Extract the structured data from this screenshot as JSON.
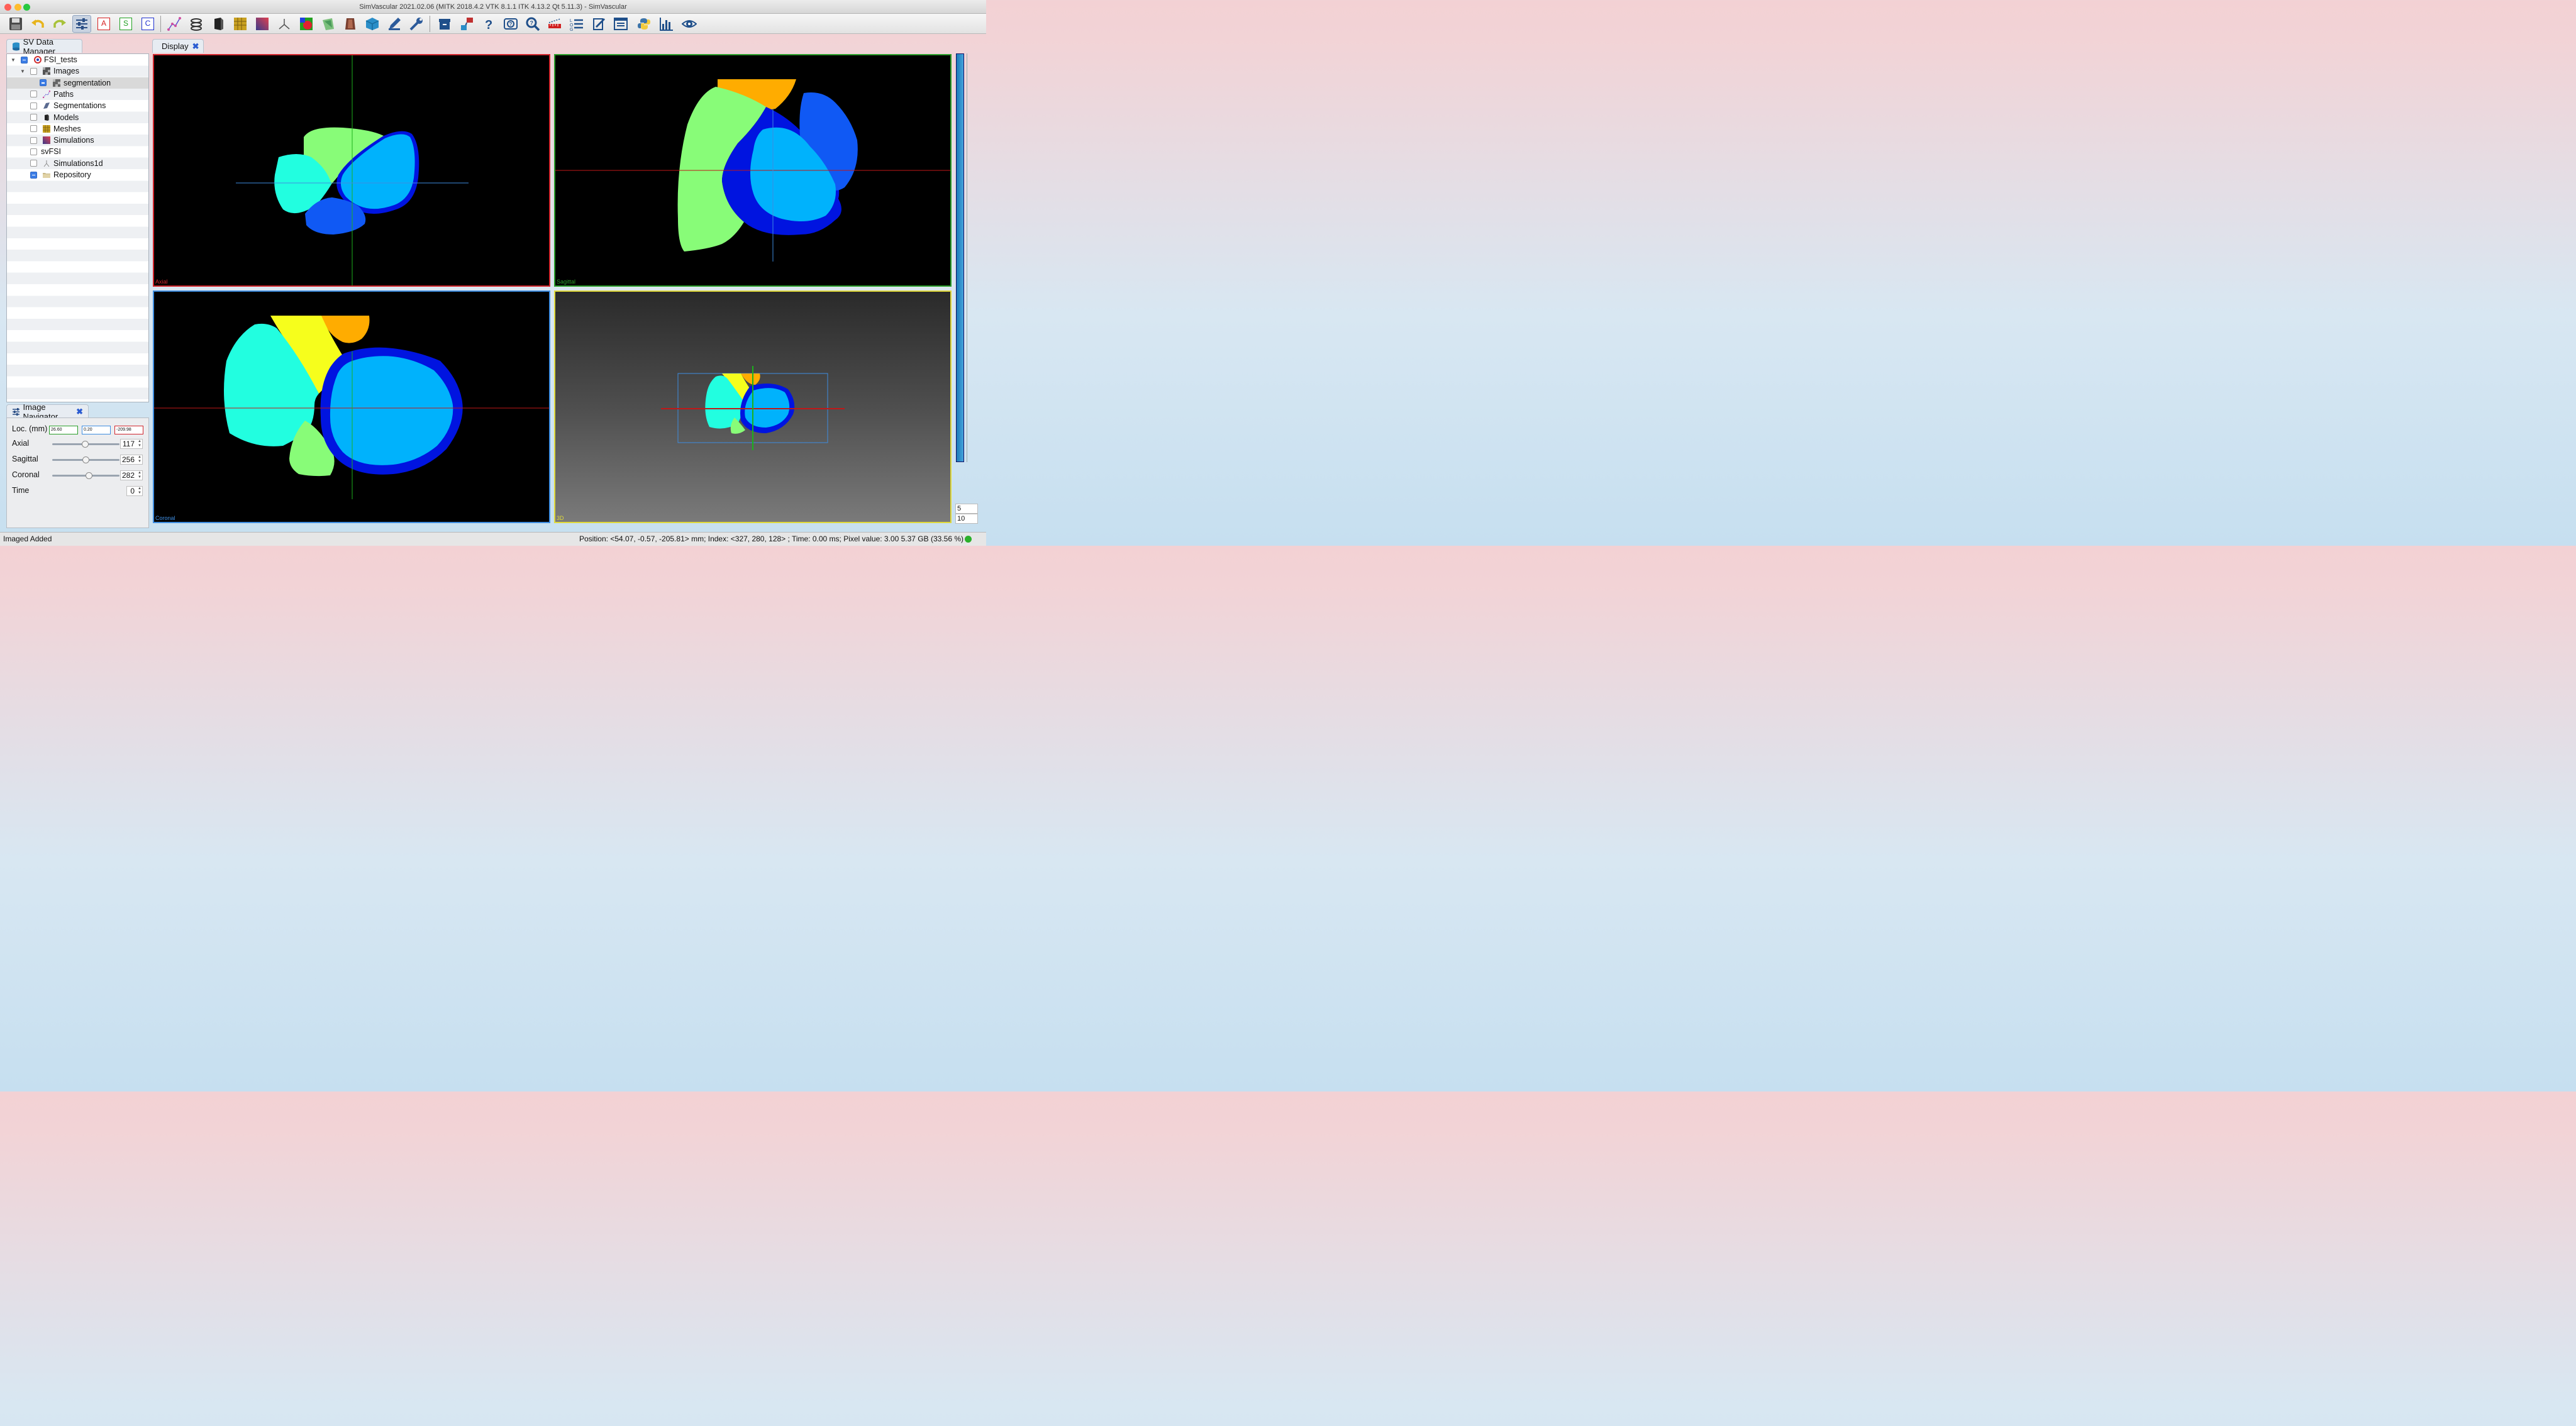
{
  "window": {
    "title": "SimVascular 2021.02.06 (MITK 2018.4.2 VTK 8.1.1 ITK 4.13.2 Qt 5.11.3) - SimVascular"
  },
  "toolbar": {
    "letter_a": "A",
    "letter_s": "S",
    "letter_c": "C",
    "icons": [
      "save-icon",
      "undo-icon",
      "redo-icon",
      "image-navigator-icon",
      "letter-a-icon",
      "letter-s-icon",
      "letter-c-icon",
      "path-planning-icon",
      "segmentation-2d-icon",
      "segmentation-3d-icon",
      "model-icon",
      "mesh-icon",
      "simulation-icon",
      "sim1d-icon",
      "svfsi-icon",
      "rom-icon",
      "warehouse-icon",
      "cube-icon",
      "pen-icon",
      "wrench-icon",
      "archive-icon",
      "transfer-icon",
      "help-icon",
      "about-icon",
      "search-icon",
      "ruler-icon",
      "log-icon",
      "properties-icon",
      "list-icon",
      "python-icon",
      "chart-icon",
      "view-icon"
    ]
  },
  "data_manager": {
    "tab_label": "SV Data Manager",
    "items": [
      {
        "label": "FSI_tests",
        "level": 0,
        "checked": true,
        "expanded": true
      },
      {
        "label": "Images",
        "level": 1,
        "checked": false,
        "expanded": true
      },
      {
        "label": "segmentation",
        "level": 2,
        "checked": true,
        "selected": true
      },
      {
        "label": "Paths",
        "level": 1,
        "checked": false
      },
      {
        "label": "Segmentations",
        "level": 1,
        "checked": false
      },
      {
        "label": "Models",
        "level": 1,
        "checked": false
      },
      {
        "label": "Meshes",
        "level": 1,
        "checked": false
      },
      {
        "label": "Simulations",
        "level": 1,
        "checked": false
      },
      {
        "label": "svFSI",
        "level": 1,
        "checked": false
      },
      {
        "label": "Simulations1d",
        "level": 1,
        "checked": false
      },
      {
        "label": "Repository",
        "level": 1,
        "checked": true
      }
    ]
  },
  "navigator": {
    "tab_label": "Image Navigator",
    "loc_label": "Loc. (mm)",
    "loc_x": "26.60",
    "loc_y": "0.20",
    "loc_z": "-209.98",
    "axial_label": "Axial",
    "axial_value": "117",
    "sagittal_label": "Sagittal",
    "sagittal_value": "256",
    "coronal_label": "Coronal",
    "coronal_value": "282",
    "time_label": "Time",
    "time_value": "0"
  },
  "display": {
    "tab_label": "Display",
    "views": {
      "axial": "Axial",
      "sagittal": "Sagittal",
      "coronal": "Coronal",
      "threed": "3D"
    }
  },
  "level_window": {
    "level": "5",
    "window": "10"
  },
  "status": {
    "message": "Imaged Added",
    "position": "Position: <54.07, -0.57, -205.81> mm; Index: <327, 280, 128> ; Time: 0.00 ms; Pixel value: 3.00",
    "memory": "5.37 GB (33.56 %)"
  },
  "colors": {
    "axial_border": "#d0262d",
    "sagittal_border": "#2a9e2a",
    "coronal_border": "#3e8de0",
    "threed_border": "#e0d93a",
    "label_green": "#88fc78",
    "label_cyan": "#22fee0",
    "label_blue_light": "#00b2fc",
    "label_blue_dark": "#0014e0",
    "label_blue_mid": "#1059f4",
    "label_yellow": "#f6fe1c",
    "label_orange": "#ffac00"
  }
}
